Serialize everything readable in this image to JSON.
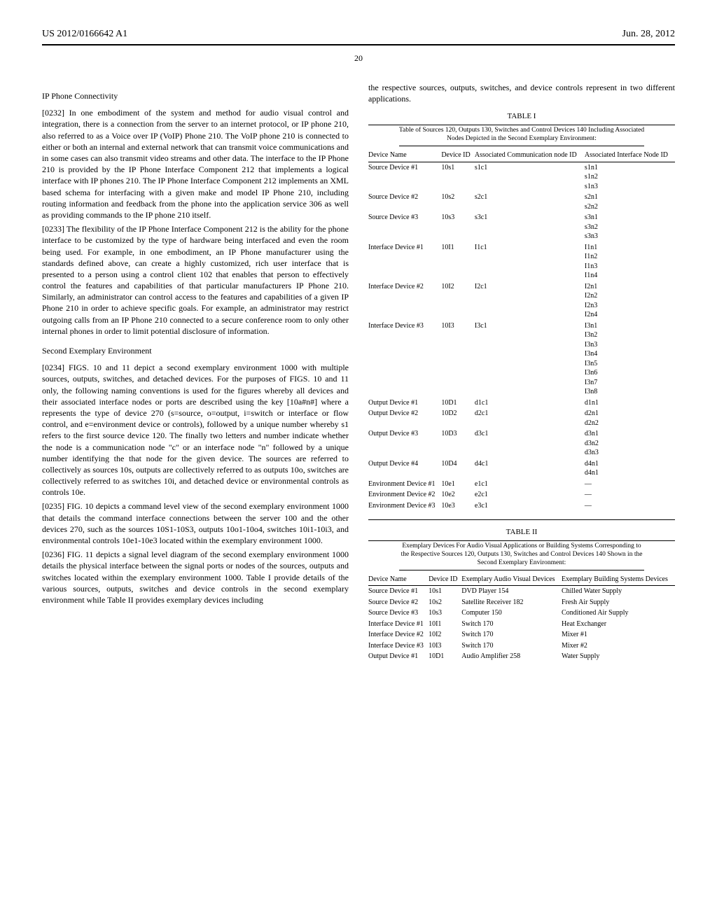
{
  "header": {
    "pub_no": "US 2012/0166642 A1",
    "date": "Jun. 28, 2012",
    "page": "20"
  },
  "left_column": {
    "heading1": "IP Phone Connectivity",
    "p0232": "[0232]   In one embodiment of the system and method for audio visual control and integration, there is a connection from the server to an internet protocol, or IP phone 210, also referred to as a Voice over IP (VoIP) Phone 210. The VoIP phone 210 is connected to either or both an internal and external network that can transmit voice communications and in some cases can also transmit video streams and other data. The interface to the IP Phone 210 is provided by the IP Phone Interface Component 212 that implements a logical interface with IP phones 210. The IP Phone Interface Component 212 implements an XML based schema for interfacing with a given make and model IP Phone 210, including routing information and feedback from the phone into the application service 306 as well as providing commands to the IP phone 210 itself.",
    "p0233": "[0233]   The flexibility of the IP Phone Interface Component 212 is the ability for the phone interface to be customized by the type of hardware being interfaced and even the room being used. For example, in one embodiment, an IP Phone manufacturer using the standards defined above, can create a highly customized, rich user interface that is presented to a person using a control client 102 that enables that person to effectively control the features and capabilities of that particular manufacturers IP Phone 210. Similarly, an administrator can control access to the features and capabilities of a given IP Phone 210 in order to achieve specific goals. For example, an administrator may restrict outgoing calls from an IP Phone 210 connected to a secure conference room to only other internal phones in order to limit potential disclosure of information.",
    "heading2": "Second Exemplary Environment",
    "p0234": "[0234]   FIGS. 10 and 11 depict a second exemplary environment 1000 with multiple sources, outputs, switches, and detached devices. For the purposes of FIGS. 10 and 11 only, the following naming conventions is used for the figures whereby all devices and their associated interface nodes or ports are described using the key [10a#n#] where a represents the type of device 270 (s=source, o=output, i=switch or interface or flow control, and e=environment device or controls), followed by a unique number whereby s1 refers to the first source device 120. The finally two letters and number indicate whether the node is a communication node \"c\" or an interface node \"n\" followed by a unique number identifying the that node for the given device. The sources are referred to collectively as sources 10s, outputs are collectively referred to as outputs 10o, switches are collectively referred to as switches 10i, and detached device or environmental controls as controls 10e.",
    "p0235": "[0235]   FIG. 10 depicts a command level view of the second exemplary environment 1000 that details the command interface connections between the server 100 and the other devices 270, such as the sources 10S1-10S3, outputs 10o1-10o4, switches 10i1-10i3, and environmental controls 10e1-10e3 located within the exemplary environment 1000.",
    "p0236": "[0236]   FIG. 11 depicts a signal level diagram of the second exemplary environment 1000 details the physical interface between the signal ports or nodes of the sources, outputs and switches located within the exemplary environment 1000. Table I provide details of the various sources, outputs, switches and device controls in the second exemplary environment while Table II provides exemplary devices including"
  },
  "right_column": {
    "top_para": "the respective sources, outputs, switches, and device controls represent in two different applications.",
    "table1": {
      "label": "TABLE I",
      "caption": "Table of Sources 120, Outputs 130, Switches and Control Devices 140 Including Associated Nodes Depicted in the Second Exemplary Environment:",
      "headers": [
        "Device Name",
        "Device ID",
        "Associated Communication node ID",
        "Associated Interface Node ID"
      ],
      "rows": [
        [
          "Source Device #1",
          "10s1",
          "s1c1",
          "s1n1\ns1n2\ns1n3"
        ],
        [
          "Source Device #2",
          "10s2",
          "s2c1",
          "s2n1\ns2n2"
        ],
        [
          "Source Device #3",
          "10s3",
          "s3c1",
          "s3n1\ns3n2\ns3n3"
        ],
        [
          "Interface Device #1",
          "10I1",
          "I1c1",
          "I1n1\nI1n2\nI1n3\nI1n4"
        ],
        [
          "Interface Device #2",
          "10I2",
          "I2c1",
          "I2n1\nI2n2\nI2n3\nI2n4"
        ],
        [
          "Interface Device #3",
          "10I3",
          "I3c1",
          "I3n1\nI3n2\nI3n3\nI3n4\nI3n5\nI3n6\nI3n7\nI3n8"
        ],
        [
          "Output Device #1",
          "10D1",
          "d1c1",
          "d1n1"
        ],
        [
          "Output Device #2",
          "10D2",
          "d2c1",
          "d2n1\nd2n2"
        ],
        [
          "Output Device #3",
          "10D3",
          "d3c1",
          "d3n1\nd3n2\nd3n3"
        ],
        [
          "Output Device #4",
          "10D4",
          "d4c1",
          "d4n1\nd4n1"
        ],
        [
          "Environment Device #1",
          "10e1",
          "e1c1",
          "—"
        ],
        [
          "Environment Device #2",
          "10e2",
          "e2c1",
          "—"
        ],
        [
          "Environment Device #3",
          "10e3",
          "e3c1",
          "—"
        ]
      ]
    },
    "table2": {
      "label": "TABLE II",
      "caption": "Exemplary Devices For Audio Visual Applications or Building Systems Corresponding to the Respective Sources 120, Outputs 130, Switches and Control Devices 140 Shown in the Second Exemplary Environment:",
      "headers": [
        "Device Name",
        "Device ID",
        "Exemplary Audio Visual Devices",
        "Exemplary Building Systems Devices"
      ],
      "rows": [
        [
          "Source Device #1",
          "10s1",
          "DVD Player 154",
          "Chilled Water Supply"
        ],
        [
          "Source Device #2",
          "10s2",
          "Satellite Receiver 182",
          "Fresh Air Supply"
        ],
        [
          "Source Device #3",
          "10s3",
          "Computer 150",
          "Conditioned Air Supply"
        ],
        [
          "Interface Device #1",
          "10I1",
          "Switch 170",
          "Heat Exchanger"
        ],
        [
          "Interface Device #2",
          "10I2",
          "Switch 170",
          "Mixer #1"
        ],
        [
          "Interface Device #3",
          "10I3",
          "Switch 170",
          "Mixer #2"
        ],
        [
          "Output Device #1",
          "10D1",
          "Audio Amplifier 258",
          "Water Supply"
        ]
      ]
    }
  }
}
